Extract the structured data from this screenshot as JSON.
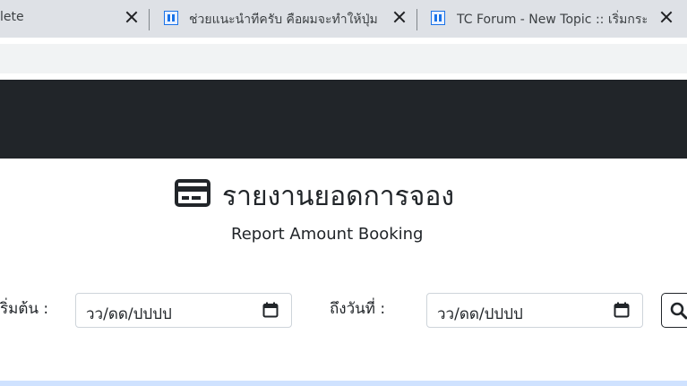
{
  "browser": {
    "tabs": [
      {
        "title": "lete"
      },
      {
        "title": "ช่วยแนะนำทีครับ คือผมจะทำให้ปุ่มสถาน"
      },
      {
        "title": "TC Forum - New Topic :: เริ่มกระทู้ใ"
      }
    ]
  },
  "header": {
    "icon": "credit-card-icon",
    "title": "รายงานยอดการจอง",
    "subtitle": "Report Amount Booking"
  },
  "form": {
    "start_label": "ริ่มต้น :",
    "end_label": "ถึงวันที่ :",
    "start_value": "วว/ดด/ปปปป",
    "end_value": "วว/ดด/ปปปป",
    "search_icon": "search-icon"
  },
  "colors": {
    "navbar": "#212529",
    "tabstrip": "#dee1e6",
    "accent_strip": "#cfe2ff"
  }
}
